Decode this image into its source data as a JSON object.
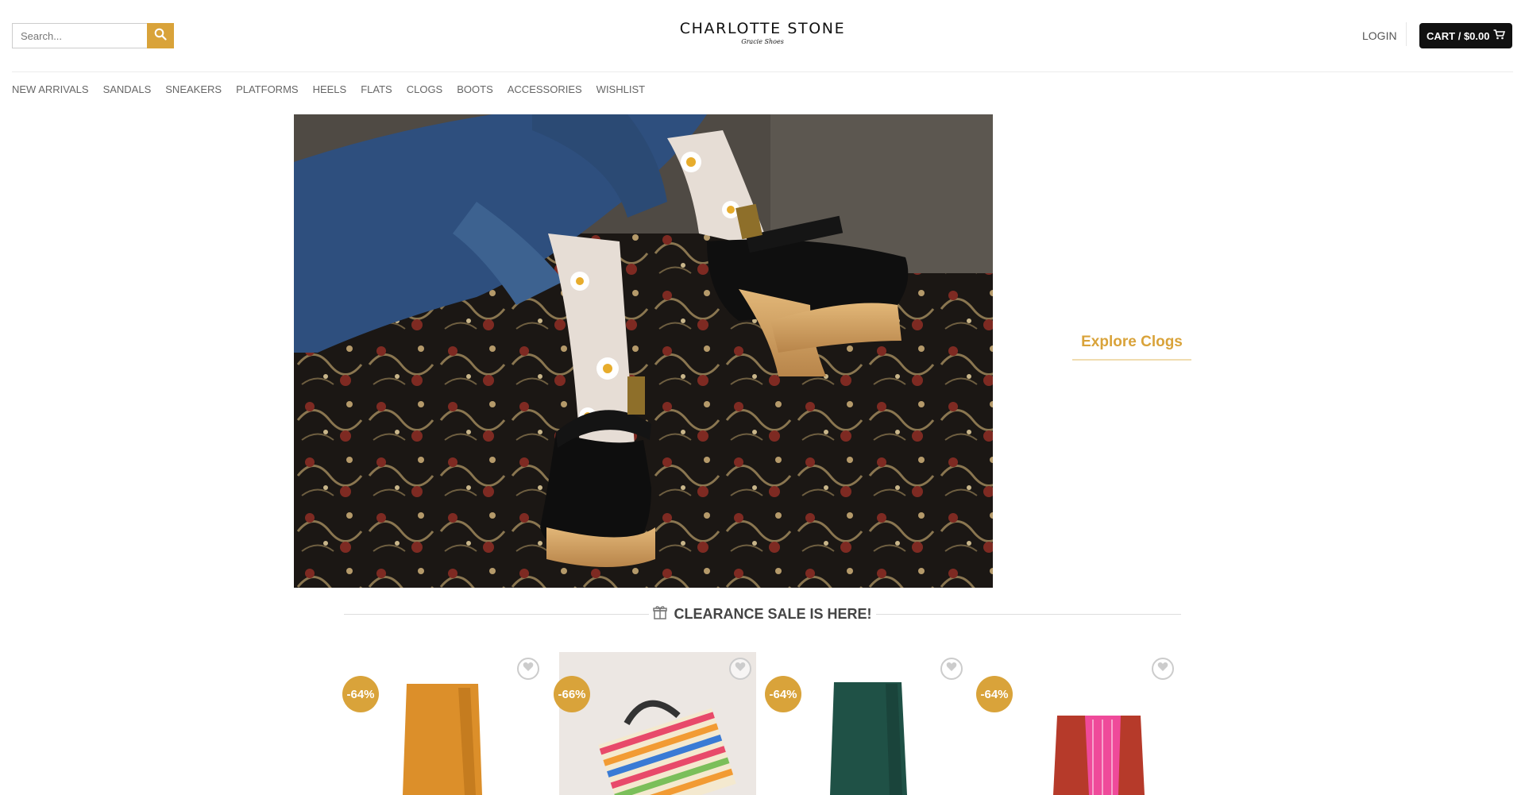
{
  "header": {
    "search": {
      "placeholder": "Search..."
    },
    "logo": {
      "brand": "CHARLOTTE STONE",
      "tagline": "Gracie Shoes"
    },
    "login_label": "LOGIN",
    "cart_label": "CART / $0.00"
  },
  "nav": {
    "items": [
      "NEW ARRIVALS",
      "SANDALS",
      "SNEAKERS",
      "PLATFORMS",
      "HEELS",
      "FLATS",
      "CLOGS",
      "BOOTS",
      "ACCESSORIES",
      "WISHLIST"
    ]
  },
  "hero": {
    "cta_label": "Explore Clogs"
  },
  "sale": {
    "title": "CLEARANCE SALE IS HERE!",
    "products": [
      {
        "badge": "-64%",
        "image": "mustard-ankle-boot"
      },
      {
        "badge": "-66%",
        "image": "rainbow-striped-bag"
      },
      {
        "badge": "-64%",
        "image": "green-ankle-boot"
      },
      {
        "badge": "-64%",
        "image": "red-pink-chelsea-boot"
      }
    ]
  },
  "colors": {
    "accent": "#d9a33a",
    "cart_bg": "#111111"
  },
  "icons": {
    "search": "search-icon",
    "cart": "cart-icon",
    "wishlist": "heart-icon",
    "sale": "gift-icon"
  }
}
